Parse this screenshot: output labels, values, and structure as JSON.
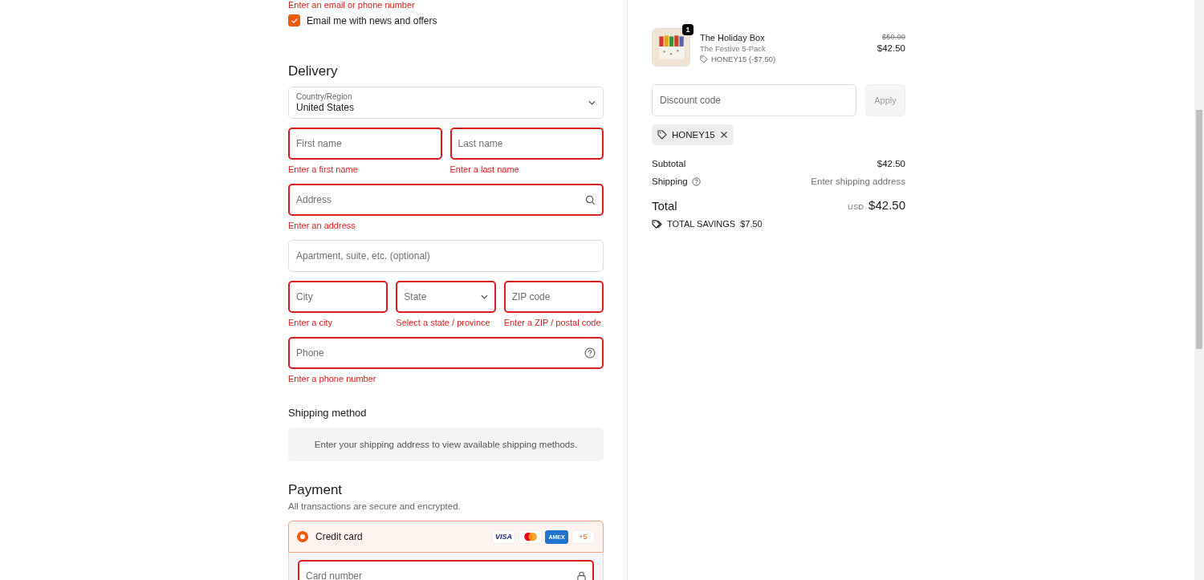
{
  "contact": {
    "error": "Enter an email or phone number",
    "newsletter": {
      "label": "Email me with news and offers",
      "checked": true
    }
  },
  "delivery": {
    "title": "Delivery",
    "rows": [
      [
        {
          "kind": "select",
          "label": "Country/Region",
          "value": "United States",
          "invalid": false
        }
      ],
      [
        {
          "kind": "text",
          "placeholder": "First name",
          "invalid": true,
          "error": "Enter a first name"
        },
        {
          "kind": "text",
          "placeholder": "Last name",
          "invalid": true,
          "error": "Enter a last name"
        }
      ],
      [
        {
          "kind": "address",
          "placeholder": "Address",
          "invalid": true,
          "error": "Enter an address"
        }
      ],
      [
        {
          "kind": "text",
          "placeholder": "Apartment, suite, etc. (optional)",
          "invalid": false
        }
      ],
      [
        {
          "kind": "text",
          "placeholder": "City",
          "invalid": true,
          "error": "Enter a city"
        },
        {
          "kind": "select",
          "placeholder": "State",
          "invalid": true,
          "error": "Select a state / province"
        },
        {
          "kind": "text",
          "placeholder": "ZIP code",
          "invalid": true,
          "error": "Enter a ZIP / postal code"
        }
      ],
      [
        {
          "kind": "phone",
          "placeholder": "Phone",
          "invalid": true,
          "error": "Enter a phone number"
        }
      ]
    ]
  },
  "shipping_method": {
    "title": "Shipping method",
    "message": "Enter your shipping address to view available shipping methods."
  },
  "payment": {
    "title": "Payment",
    "subtitle": "All transactions are secure and encrypted.",
    "methods": [
      {
        "label": "Credit card",
        "selected": true,
        "brands": [
          {
            "kind": "visa",
            "label": "VISA"
          },
          {
            "kind": "mastercard"
          },
          {
            "kind": "amex",
            "label": "AMEX"
          }
        ],
        "more": "+5"
      }
    ],
    "card_number": {
      "placeholder": "Card number",
      "invalid": true
    }
  },
  "summary": {
    "item": {
      "quantity": "1",
      "name": "The Holiday Box",
      "variant": "The Festive 5-Pack",
      "discount": "HONEY15 (-$7.50)",
      "original_price": "$50.00",
      "price": "$42.50"
    },
    "discount_field": {
      "placeholder": "Discount code"
    },
    "apply_button": {
      "label": "Apply",
      "disabled": true
    },
    "applied_codes": [
      "HONEY15"
    ],
    "subtotal": {
      "label": "Subtotal",
      "value": "$42.50"
    },
    "shipping": {
      "label": "Shipping",
      "value": "Enter shipping address"
    },
    "total": {
      "label": "Total",
      "currency": "USD",
      "value": "$42.50"
    },
    "savings": {
      "label": "TOTAL SAVINGS",
      "value": "$7.50"
    }
  }
}
